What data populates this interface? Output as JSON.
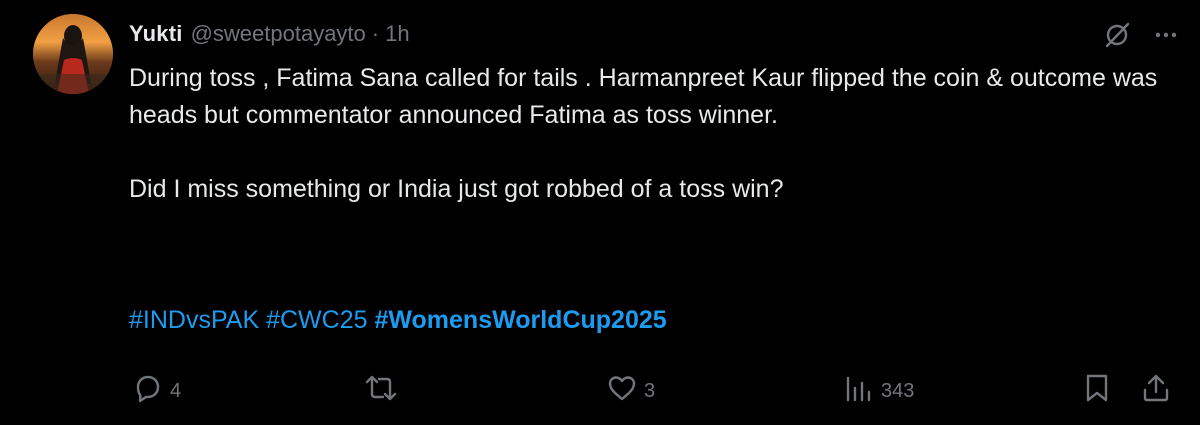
{
  "tweet": {
    "author": {
      "display_name": "Yukti",
      "handle": "@sweetpotayayto",
      "separator": "·",
      "time": "1h"
    },
    "text": {
      "paragraph1": "During toss , Fatima Sana called for tails . Harmanpreet Kaur flipped the coin & outcome was heads but commentator announced Fatima as toss winner.",
      "paragraph2": "Did I miss something or India just got robbed of a toss win?"
    },
    "hashtags": [
      "#INDvsPAK",
      "#CWC25",
      "#WomensWorldCup2025"
    ],
    "stats": {
      "replies": "4",
      "likes": "3",
      "views": "343"
    },
    "icons": {
      "grok": "grok-icon",
      "more": "more-icon",
      "reply": "reply-icon",
      "retweet": "retweet-icon",
      "like": "heart-icon",
      "views": "views-icon",
      "bookmark": "bookmark-icon",
      "share": "share-icon"
    },
    "colors": {
      "background": "#000000",
      "text": "#e7e9ea",
      "muted": "#71767b",
      "link": "#1d9bf0"
    }
  }
}
